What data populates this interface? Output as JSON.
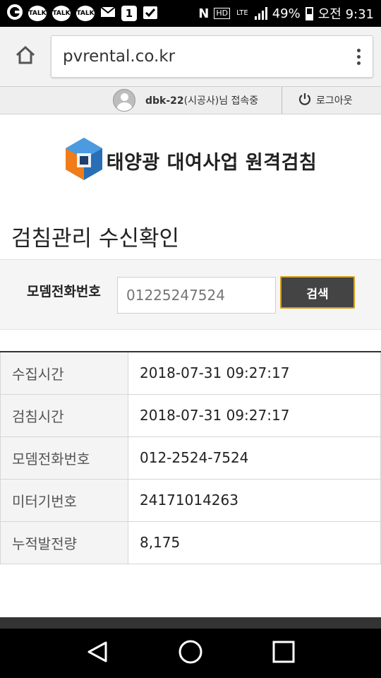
{
  "status_bar": {
    "left_icons": [
      "ring-icon",
      "talk-icon",
      "talk-icon",
      "talk-icon",
      "mail-icon",
      "one-icon",
      "check-icon"
    ],
    "talk_label": "TALK",
    "one_label": "1",
    "nfc_label": "N",
    "hd_label": "HD",
    "lte_label": "LTE",
    "battery": "49%",
    "time": "오전 9:31"
  },
  "browser": {
    "url": "pvrental.co.kr"
  },
  "user_bar": {
    "user_id": "dbk-22",
    "user_role": "(시공사)님 접속중",
    "logout_label": "로그아웃"
  },
  "header": {
    "logo_text": "태양광 대여사업 원격검침",
    "colors": {
      "logo_blue": "#2a6fb6",
      "logo_orange": "#f07d19",
      "logo_dark": "#1f3f6b"
    }
  },
  "page": {
    "title": "검침관리 수신확인"
  },
  "search": {
    "label": "모뎀전화번호",
    "placeholder": "01225247524",
    "button_label": "검색",
    "button_border_color": "#d4a017"
  },
  "details": [
    {
      "key": "수집시간",
      "value": "2018-07-31 09:27:17"
    },
    {
      "key": "검침시간",
      "value": "2018-07-31 09:27:17"
    },
    {
      "key": "모뎀전화번호",
      "value": "012-2524-7524"
    },
    {
      "key": "미터기번호",
      "value": "24171014263"
    },
    {
      "key": "누적발전량",
      "value": "8,175"
    }
  ],
  "nav": [
    "back-icon",
    "home-icon",
    "recents-icon"
  ]
}
